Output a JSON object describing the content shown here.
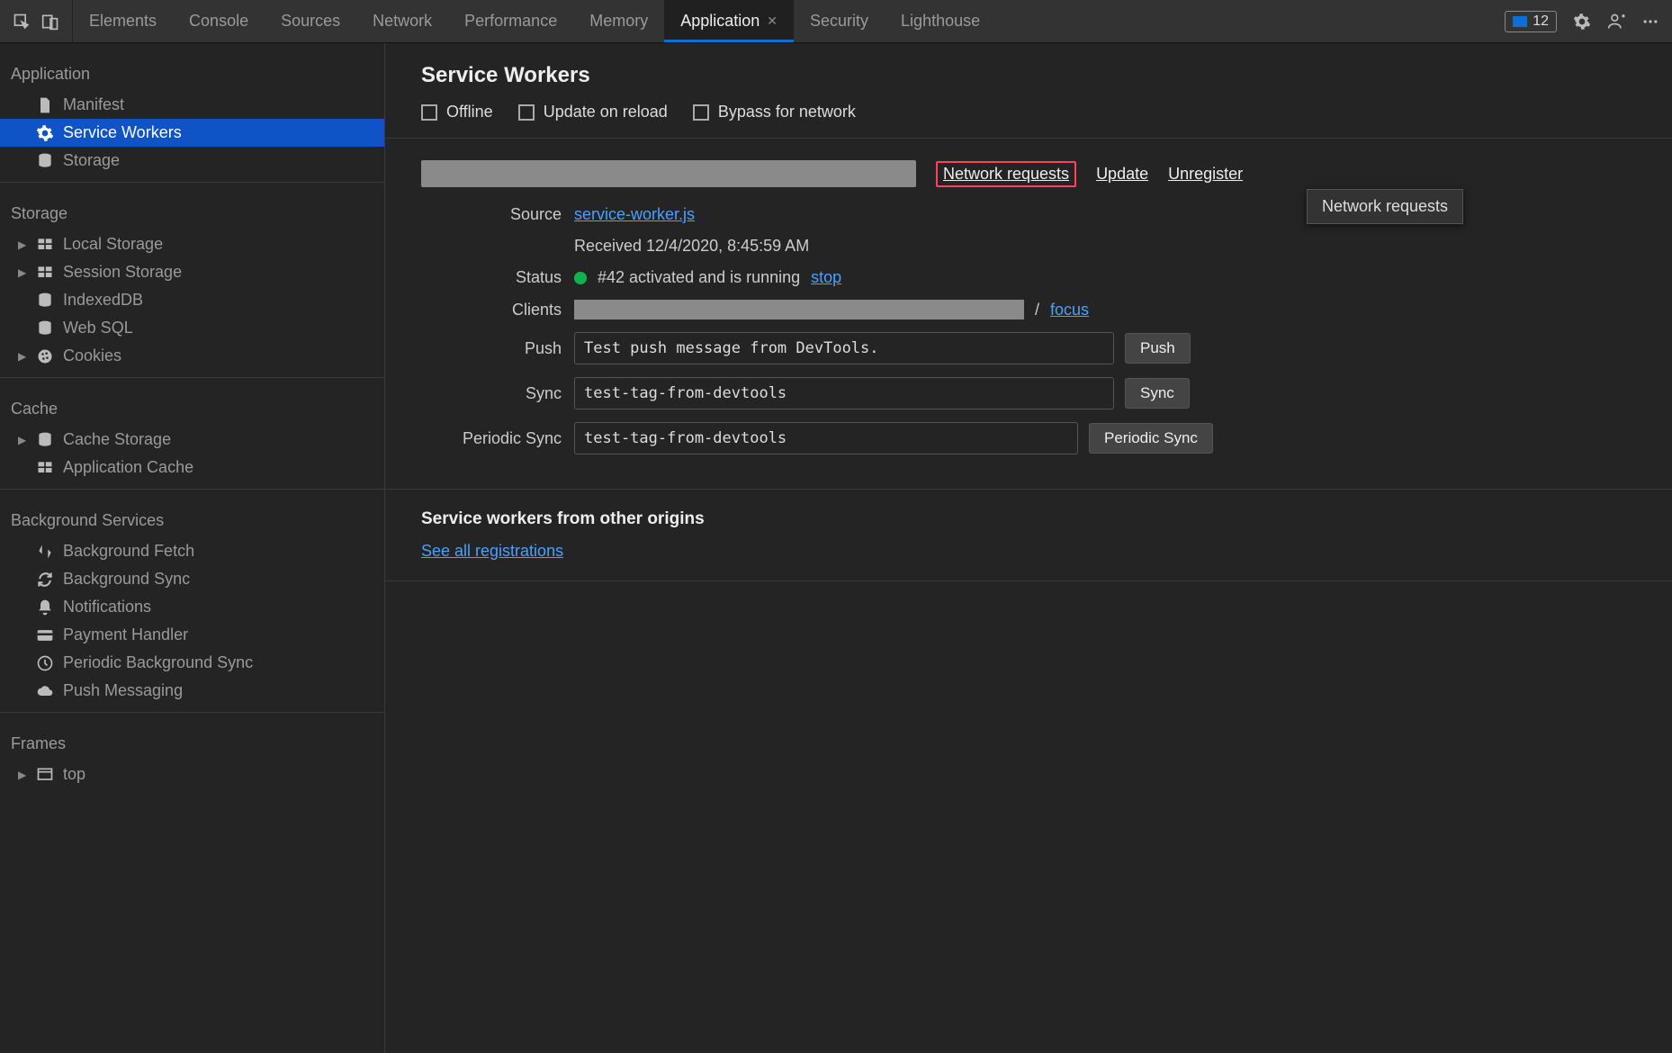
{
  "tabs": {
    "items": [
      "Elements",
      "Console",
      "Sources",
      "Network",
      "Performance",
      "Memory",
      "Application",
      "Security",
      "Lighthouse"
    ],
    "active_index": 6
  },
  "badge": {
    "count": "12"
  },
  "sidebar": {
    "groups": [
      {
        "title": "Application",
        "items": [
          {
            "label": "Manifest",
            "icon": "file-icon",
            "expandable": false,
            "selected": false
          },
          {
            "label": "Service Workers",
            "icon": "gear-icon",
            "expandable": false,
            "selected": true
          },
          {
            "label": "Storage",
            "icon": "database-icon",
            "expandable": false,
            "selected": false
          }
        ]
      },
      {
        "title": "Storage",
        "items": [
          {
            "label": "Local Storage",
            "icon": "table-icon",
            "expandable": true
          },
          {
            "label": "Session Storage",
            "icon": "table-icon",
            "expandable": true
          },
          {
            "label": "IndexedDB",
            "icon": "database-icon",
            "expandable": false
          },
          {
            "label": "Web SQL",
            "icon": "database-icon",
            "expandable": false
          },
          {
            "label": "Cookies",
            "icon": "cookie-icon",
            "expandable": true
          }
        ]
      },
      {
        "title": "Cache",
        "items": [
          {
            "label": "Cache Storage",
            "icon": "database-icon",
            "expandable": true
          },
          {
            "label": "Application Cache",
            "icon": "table-icon",
            "expandable": false
          }
        ]
      },
      {
        "title": "Background Services",
        "items": [
          {
            "label": "Background Fetch",
            "icon": "updown-icon",
            "expandable": false
          },
          {
            "label": "Background Sync",
            "icon": "sync-icon",
            "expandable": false
          },
          {
            "label": "Notifications",
            "icon": "bell-icon",
            "expandable": false
          },
          {
            "label": "Payment Handler",
            "icon": "card-icon",
            "expandable": false
          },
          {
            "label": "Periodic Background Sync",
            "icon": "clock-icon",
            "expandable": false
          },
          {
            "label": "Push Messaging",
            "icon": "cloud-icon",
            "expandable": false
          }
        ]
      },
      {
        "title": "Frames",
        "items": [
          {
            "label": "top",
            "icon": "frame-icon",
            "expandable": true
          }
        ]
      }
    ]
  },
  "main": {
    "heading": "Service Workers",
    "checkboxes": {
      "offline": "Offline",
      "update": "Update on reload",
      "bypass": "Bypass for network"
    },
    "origin_actions": {
      "network_requests": "Network requests",
      "update": "Update",
      "unregister": "Unregister"
    },
    "tooltip": "Network requests",
    "rows": {
      "source": {
        "label": "Source",
        "link": "service-worker.js",
        "received": "Received 12/4/2020, 8:45:59 AM"
      },
      "status": {
        "label": "Status",
        "text": "#42 activated and is running",
        "action": "stop"
      },
      "clients": {
        "label": "Clients",
        "trail": "/",
        "action": "focus"
      },
      "push": {
        "label": "Push",
        "value": "Test push message from DevTools.",
        "button": "Push"
      },
      "sync": {
        "label": "Sync",
        "value": "test-tag-from-devtools",
        "button": "Sync"
      },
      "psync": {
        "label": "Periodic Sync",
        "value": "test-tag-from-devtools",
        "button": "Periodic Sync"
      }
    },
    "other": {
      "heading": "Service workers from other origins",
      "link": "See all registrations"
    }
  }
}
